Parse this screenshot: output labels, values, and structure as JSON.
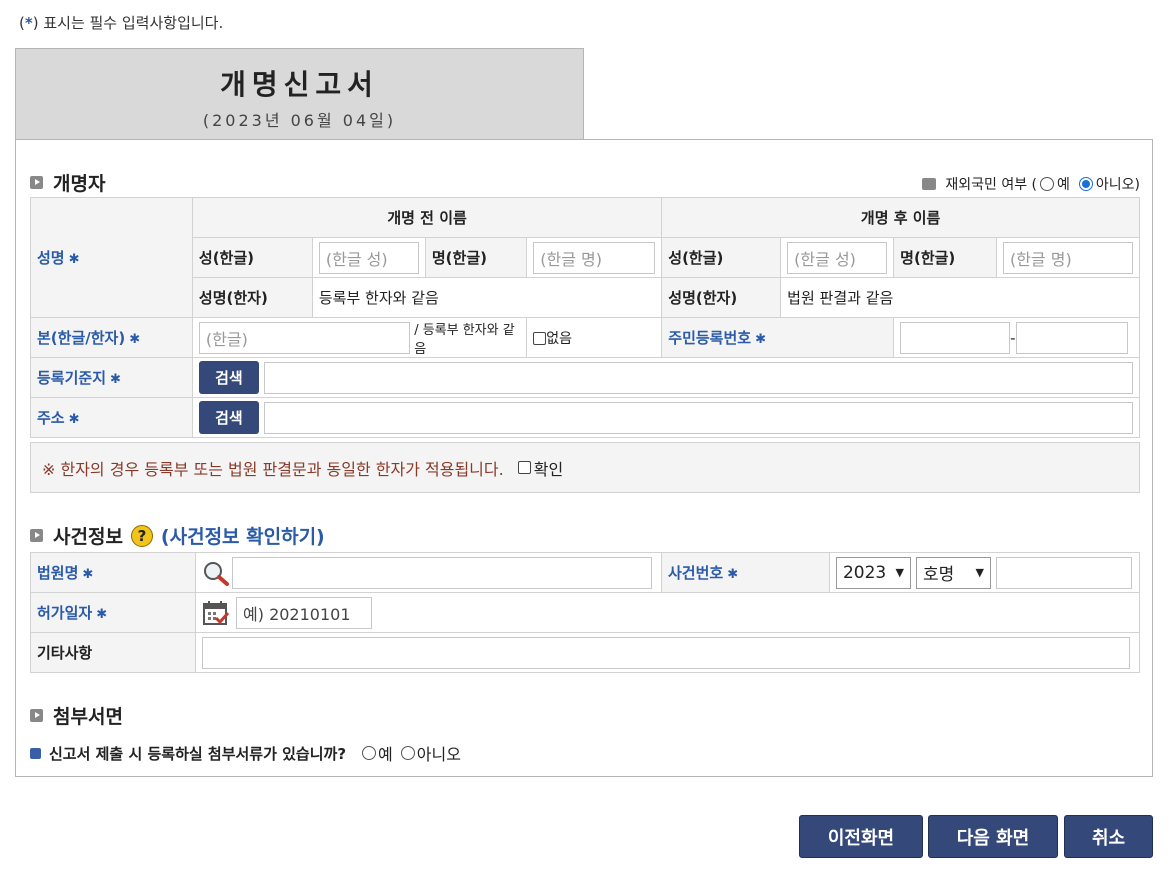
{
  "required_note": {
    "prefix": "(",
    "star": "*",
    "suffix": ") 표시는 필수 입력사항입니다."
  },
  "title": {
    "main": "개명신고서",
    "date": "(2023년 06월 04일)"
  },
  "section_renamer": {
    "heading": "개명자",
    "overseas": {
      "label": "재외국민 여부 (",
      "yes": "예",
      "no": "아니오)",
      "selected": "no"
    },
    "before_header": "개명 전 이름",
    "after_header": "개명 후 이름",
    "name_label": "성명",
    "surname_kr_label": "성(한글)",
    "given_kr_label": "명(한글)",
    "surname_placeholder": "(한글 성)",
    "given_placeholder": "(한글 명)",
    "hanja_label": "성명(한자)",
    "hanja_before_value": "등록부 한자와 같음",
    "hanja_after_value": "법원 판결과 같음",
    "origin_label": "본(한글/한자)",
    "origin_placeholder": "(한글)",
    "origin_hanja_note": "/ 등록부 한자와 같음",
    "origin_none_label": "없음",
    "rrn_label": "주민등록번호",
    "rrn_dash": "-",
    "reg_base_label": "등록기준지",
    "address_label": "주소",
    "search_label": "검색"
  },
  "notice": {
    "message": "※ 한자의 경우 등록부 또는 법원 판결문과 동일한 한자가 적용됩니다.",
    "confirm_label": "확인"
  },
  "section_case": {
    "heading": "사건정보",
    "help": "?",
    "link": "(사건정보 확인하기)",
    "court_label": "법원명",
    "case_no_label": "사건번호",
    "year_value": "2023",
    "type_value": "호명",
    "permit_date_label": "허가일자",
    "permit_date_placeholder": "예) 20210101",
    "etc_label": "기타사항"
  },
  "section_attach": {
    "heading": "첨부서면",
    "question": "신고서 제출 시 등록하실 첨부서류가 있습니까?",
    "yes": "예",
    "no": "아니오"
  },
  "actions": {
    "prev": "이전화면",
    "next": "다음 화면",
    "cancel": "취소"
  },
  "colors": {
    "accent_blue": "#2a5aa8",
    "button_navy": "#34497a",
    "notice_text": "#8a3a2a",
    "header_gray": "#d9d9d9"
  }
}
